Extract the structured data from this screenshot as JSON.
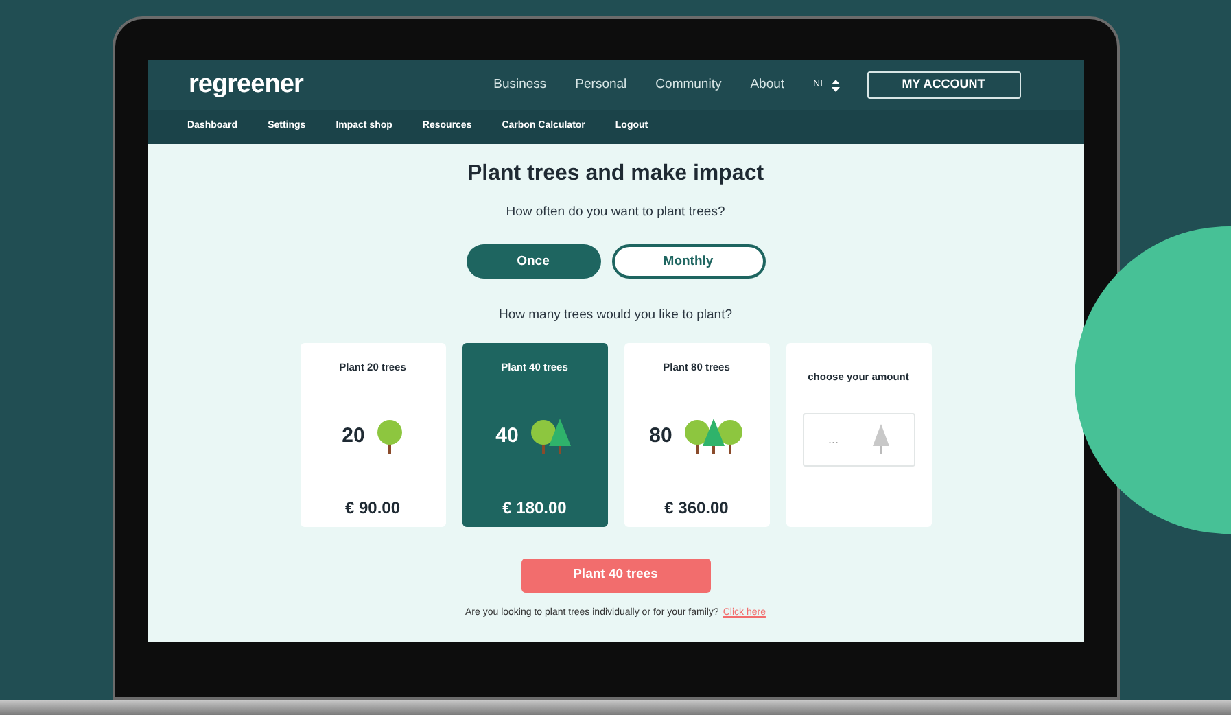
{
  "header": {
    "logo": "regreener",
    "nav": [
      "Business",
      "Personal",
      "Community",
      "About"
    ],
    "language": "NL",
    "account_button": "MY ACCOUNT"
  },
  "subnav": [
    "Dashboard",
    "Settings",
    "Impact shop",
    "Resources",
    "Carbon Calculator",
    "Logout"
  ],
  "title": "Plant trees and make impact",
  "frequency_question": "How often do you want to plant trees?",
  "frequency_options": [
    {
      "label": "Once",
      "selected": true
    },
    {
      "label": "Monthly",
      "selected": false
    }
  ],
  "amount_question": "How many trees would you like to plant?",
  "cards": [
    {
      "kind": "preset",
      "title": "Plant 20 trees",
      "count": "20",
      "price": "€ 90.00",
      "selected": false
    },
    {
      "kind": "preset",
      "title": "Plant 40 trees",
      "count": "40",
      "price": "€ 180.00",
      "selected": true
    },
    {
      "kind": "preset",
      "title": "Plant 80 trees",
      "count": "80",
      "price": "€ 360.00",
      "selected": false
    },
    {
      "kind": "custom",
      "title": "choose your amount",
      "placeholder": "...",
      "selected": false
    }
  ],
  "submit_button": "Plant 40 trees",
  "footer": {
    "text": "Are you looking to plant trees individually or for your family?",
    "link": "Click here"
  }
}
